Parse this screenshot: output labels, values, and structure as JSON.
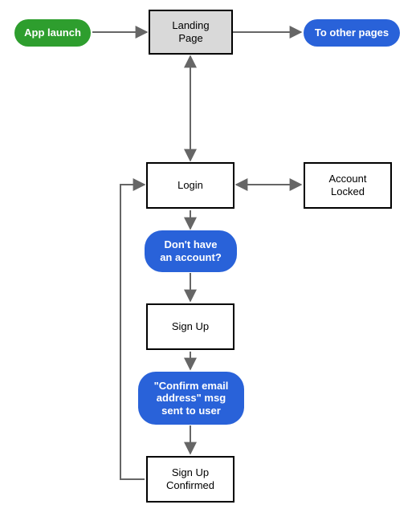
{
  "nodes": {
    "app_launch": "App launch",
    "landing_page": "Landing\nPage",
    "to_other_pages": "To other pages",
    "login": "Login",
    "account_locked": "Account\nLocked",
    "no_account": "Don't have\nan account?",
    "sign_up": "Sign Up",
    "confirm_email": "\"Confirm email\naddress\" msg\nsent to user",
    "sign_up_confirmed": "Sign Up\nConfirmed"
  },
  "colors": {
    "green": "#2e9e2e",
    "blue": "#2962d9",
    "arrow": "#666666",
    "node_border": "#000000",
    "shaded_fill": "#d9d9d9"
  },
  "edges": [
    {
      "from": "app_launch",
      "to": "landing_page",
      "bidirectional": false
    },
    {
      "from": "landing_page",
      "to": "to_other_pages",
      "bidirectional": false
    },
    {
      "from": "landing_page",
      "to": "login",
      "bidirectional": true
    },
    {
      "from": "login",
      "to": "account_locked",
      "bidirectional": true
    },
    {
      "from": "login",
      "to": "no_account",
      "bidirectional": false
    },
    {
      "from": "no_account",
      "to": "sign_up",
      "bidirectional": false
    },
    {
      "from": "sign_up",
      "to": "confirm_email",
      "bidirectional": false
    },
    {
      "from": "confirm_email",
      "to": "sign_up_confirmed",
      "bidirectional": false
    },
    {
      "from": "sign_up_confirmed",
      "to": "login",
      "bidirectional": false
    }
  ]
}
